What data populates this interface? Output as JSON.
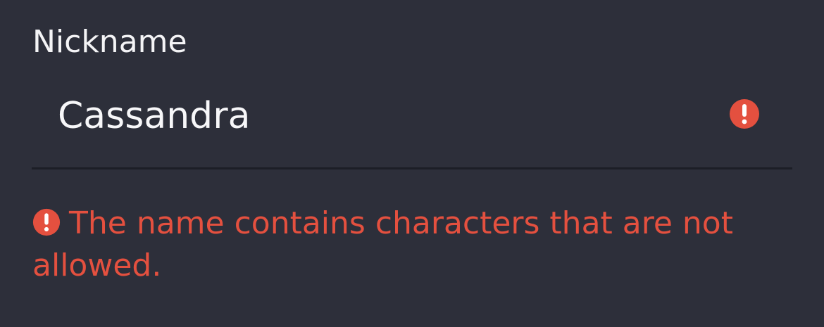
{
  "form": {
    "nickname_label": "Nickname",
    "nickname_value": "Cassandra",
    "error_message": "The name contains characters that are not allowed."
  },
  "icons": {
    "field_error": "error-circle-icon",
    "message_error": "error-circle-icon"
  },
  "colors": {
    "background": "#2d2f3a",
    "text": "#f4f4f6",
    "error": "#e4503f",
    "divider": "#1c1e26"
  }
}
